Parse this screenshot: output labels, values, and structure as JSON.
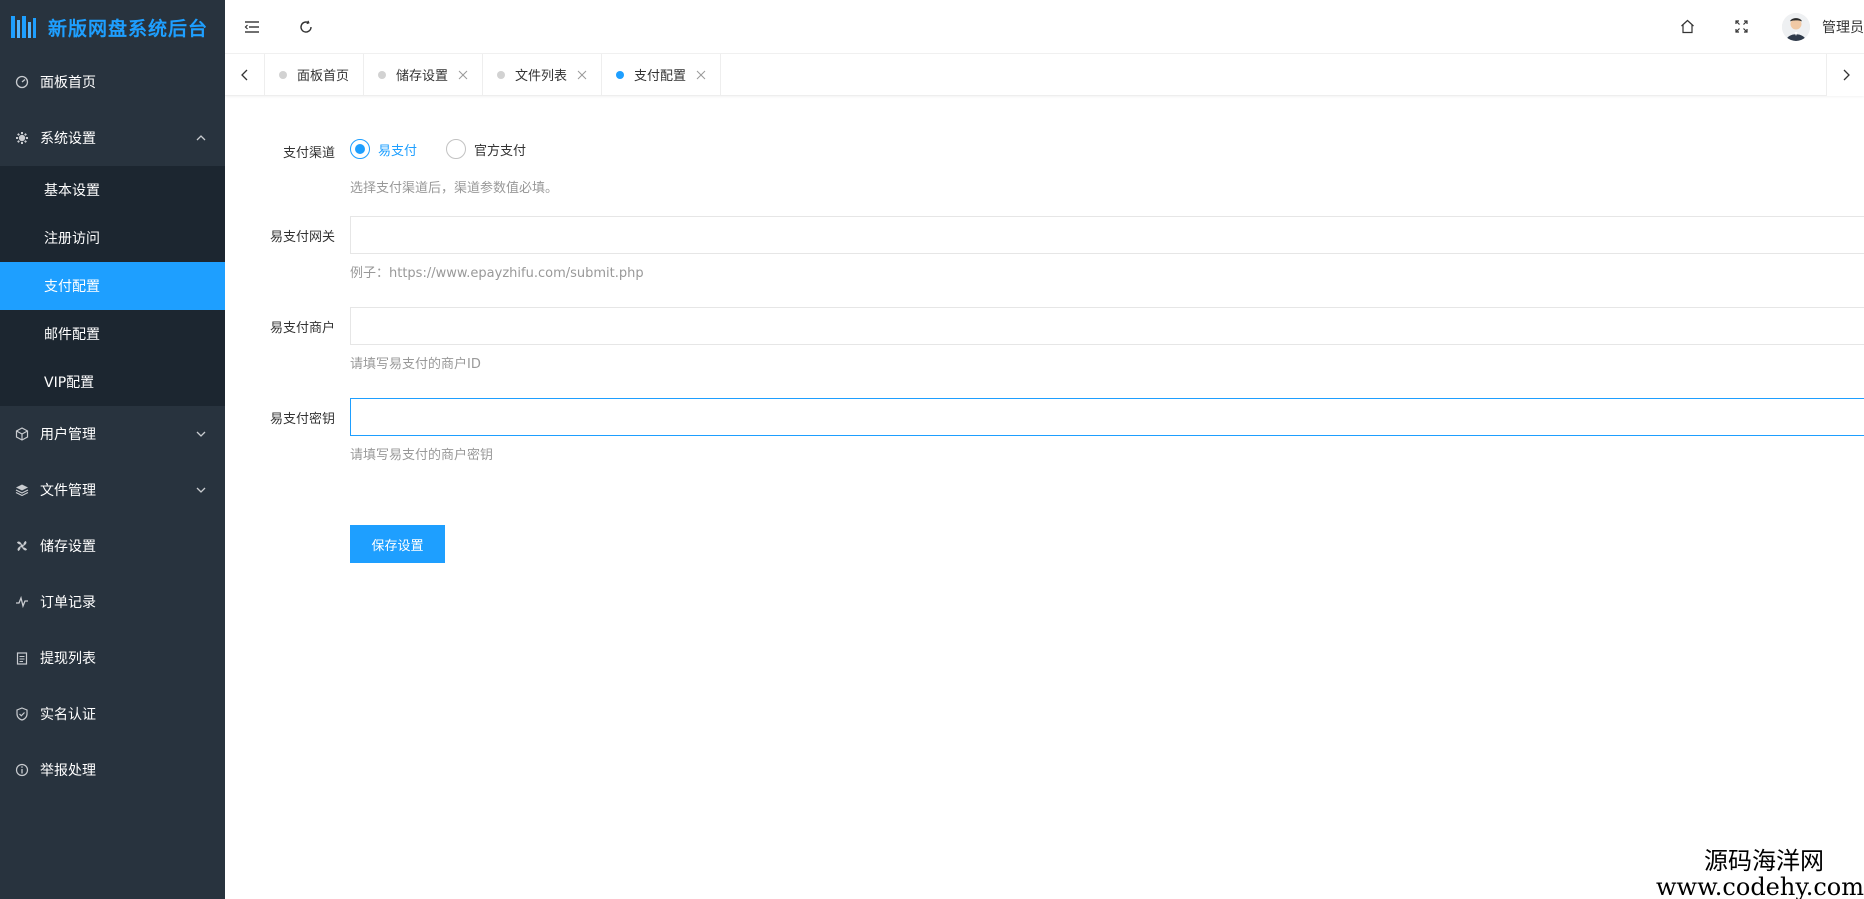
{
  "brand": {
    "title": "新版网盘系统后台"
  },
  "sidebar": {
    "items": [
      {
        "label": "面板首页",
        "icon": "dashboard-icon"
      },
      {
        "label": "系统设置",
        "icon": "gear-icon",
        "expanded": true,
        "children": [
          {
            "label": "基本设置"
          },
          {
            "label": "注册访问"
          },
          {
            "label": "支付配置",
            "active": true
          },
          {
            "label": "邮件配置"
          },
          {
            "label": "VIP配置"
          }
        ]
      },
      {
        "label": "用户管理",
        "icon": "cube-icon",
        "expandable": true
      },
      {
        "label": "文件管理",
        "icon": "layers-icon",
        "expandable": true
      },
      {
        "label": "储存设置",
        "icon": "fan-icon"
      },
      {
        "label": "订单记录",
        "icon": "pulse-icon"
      },
      {
        "label": "提现列表",
        "icon": "clipboard-icon"
      },
      {
        "label": "实名认证",
        "icon": "shield-check-icon"
      },
      {
        "label": "举报处理",
        "icon": "info-circle-icon"
      }
    ]
  },
  "header": {
    "user_name": "管理员"
  },
  "tabs": [
    {
      "label": "面板首页",
      "closable": false,
      "active": false
    },
    {
      "label": "储存设置",
      "closable": true,
      "active": false
    },
    {
      "label": "文件列表",
      "closable": true,
      "active": false
    },
    {
      "label": "支付配置",
      "closable": true,
      "active": true
    }
  ],
  "form": {
    "channel": {
      "label": "支付渠道",
      "options": [
        {
          "label": "易支付",
          "checked": true
        },
        {
          "label": "官方支付",
          "checked": false
        }
      ],
      "help": "选择支付渠道后，渠道参数值必填。"
    },
    "gateway": {
      "label": "易支付网关",
      "value": "",
      "help": "例子：https://www.epayzhifu.com/submit.php"
    },
    "merchant": {
      "label": "易支付商户",
      "value": "",
      "help": "请填写易支付的商户ID"
    },
    "secret": {
      "label": "易支付密钥",
      "value": "",
      "help": "请填写易支付的商户密钥"
    },
    "save_label": "保存设置"
  },
  "watermark": {
    "line1": "源码海洋网",
    "line2": "www.codehy.com"
  },
  "colors": {
    "accent": "#1e9fff",
    "sidebar_bg": "#28333e",
    "submenu_bg": "#1c2630"
  }
}
